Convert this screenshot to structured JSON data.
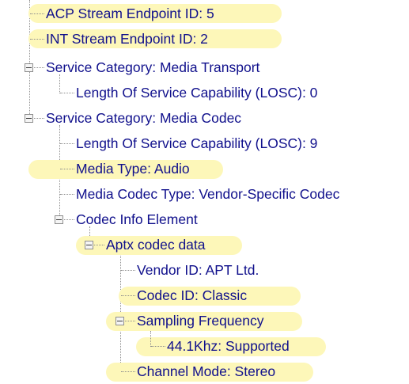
{
  "tree": {
    "nodes": [
      {
        "id": "n0",
        "label": "ACP Stream Endpoint ID: 5"
      },
      {
        "id": "n1",
        "label": "INT Stream Endpoint ID: 2"
      },
      {
        "id": "n2",
        "label": "Service Category: Media Transport"
      },
      {
        "id": "n3",
        "label": "Length Of Service Capability (LOSC): 0"
      },
      {
        "id": "n4",
        "label": "Service Category: Media Codec"
      },
      {
        "id": "n5",
        "label": "Length Of Service Capability (LOSC): 9"
      },
      {
        "id": "n6",
        "label": "Media Type: Audio"
      },
      {
        "id": "n7",
        "label": "Media Codec Type: Vendor-Specific Codec"
      },
      {
        "id": "n8",
        "label": "Codec Info Element"
      },
      {
        "id": "n9",
        "label": "Aptx codec data"
      },
      {
        "id": "n10",
        "label": "Vendor ID: APT Ltd."
      },
      {
        "id": "n11",
        "label": "Codec ID: Classic"
      },
      {
        "id": "n12",
        "label": "Sampling Frequency"
      },
      {
        "id": "n13",
        "label": "44.1Khz: Supported"
      },
      {
        "id": "n14",
        "label": "Channel Mode: Stereo"
      }
    ]
  }
}
